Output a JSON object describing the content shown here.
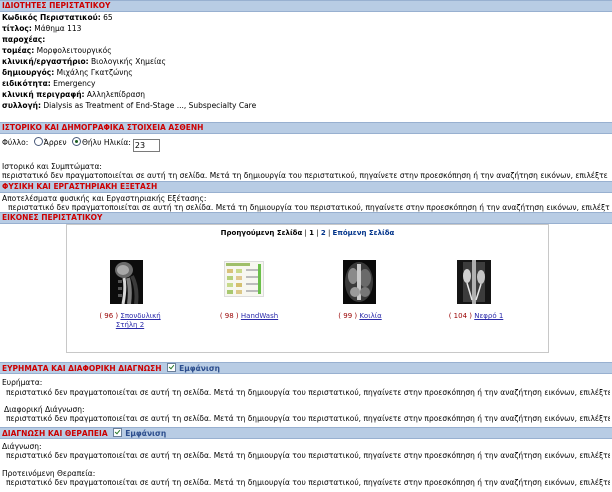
{
  "sections": {
    "properties": "ΙΔΙΟΤΗΤΕΣ ΠΕΡΙΣΤΑΤΙΚΟΥ",
    "history": "ΙΣΤΟΡΙΚΟ ΚΑΙ ΔΗΜΟΓΡΑΦΙΚΑ ΣΤΟΙΧΕΙΑ ΑΣΘΕΝΗ",
    "exam": "ΦΥΣΙΚΗ ΚΑΙ ΕΡΓΑΣΤΗΡΙΑΚΗ ΕΞΕΤΑΣΗ",
    "images": "ΕΙΚΟΝΕΣ ΠΕΡΙΣΤΑΤΙΚΟΥ",
    "findings": "ΕΥΡΗΜΑΤΑ ΚΑΙ ΔΙΑΦΟΡΙΚΗ ΔΙΑΓΝΩΣΗ",
    "diagnosis": "ΔΙΑΓΝΩΣΗ ΚΑΙ ΘΕΡΑΠΕΙΑ",
    "show_label": "Εμφάνιση"
  },
  "properties": [
    {
      "label": "Κωδικός Περιστατικού:",
      "value": "  65"
    },
    {
      "label": "τίτλος:",
      "value": " Μάθημα 113"
    },
    {
      "label": "παροχέας:",
      "value": ""
    },
    {
      "label": "τομέας:",
      "value": " Μορφολειτουργικός"
    },
    {
      "label": "κλινική/εργαστήριο:",
      "value": " Βιολογικής Χημείας"
    },
    {
      "label": "δημιουργός:",
      "value": " Μιχάλης Γκατζώνης"
    },
    {
      "label": "ειδικότητα:",
      "value": " Emergency"
    },
    {
      "label": "κλινική περιγραφή:",
      "value": " Αλληλεπίδραση"
    },
    {
      "label": "συλλογή:",
      "value": " Dialysis as Treatment of End-Stage ..., Subspecialty Care"
    }
  ],
  "demographics": {
    "sex_label": "Φύλλο:",
    "male": "Άρρεν",
    "female": "Θήλυ",
    "age_label": "Ηλικία:",
    "age_value": "23"
  },
  "history": {
    "label": "Ιστορικό και Συμπτώματα:",
    "text": "περιστατικό δεν πραγματοποιείται σε αυτή τη σελίδα. Μετά τη δημιουργία του περιστατικού, πηγαίνετε στην προεσκόπηση ή την αναζήτηση εικόνων, επιλέξτε την εικόνα (ή τις εικόνες) που θέλετε"
  },
  "exam": {
    "label": "Αποτελέσματα φυσικής και Εργαστηριακής Εξέτασης:",
    "text": "περιστατικό δεν πραγματοποιείται σε αυτή τη σελίδα. Μετά τη δημιουργία του περιστατικού, πηγαίνετε στην προεσκόπηση ή την αναζήτηση εικόνων, επιλέξτε την εικόνα (ή τις εικόνες) που θέλετε"
  },
  "gallery": {
    "prev": "Προηγούμενη Σελίδα",
    "sep": "|",
    "page1": "1",
    "page2": "2",
    "next": "Επόμενη Σελίδα",
    "items": [
      {
        "num": "( 96 )",
        "name": "Σπονδυλική",
        "name2": "Στήλη 2"
      },
      {
        "num": "( 98 )",
        "name": "HandWash",
        "name2": ""
      },
      {
        "num": "( 99 )",
        "name": "Κοιλία",
        "name2": ""
      },
      {
        "num": "( 104 )",
        "name": "Νεφρό 1",
        "name2": ""
      }
    ]
  },
  "findings": {
    "label1": "Ευρήματα:",
    "text1": "περιστατικό δεν πραγματοποιείται σε αυτή τη σελίδα. Μετά τη δημιουργία του περιστατικού, πηγαίνετε στην προεσκόπηση ή την αναζήτηση εικόνων, επιλέξτε την εικόνα (ή τις εικόνες) που θέλετε",
    "label2": "Διαφορική Διάγνωση:",
    "text2": "περιστατικό δεν πραγματοποιείται σε αυτή τη σελίδα. Μετά τη δημιουργία του περιστατικού, πηγαίνετε στην προεσκόπηση ή την αναζήτηση εικόνων, επιλέξτε την εικόνα (ή τις εικόνες) που θέλετε"
  },
  "diagnosis": {
    "label1": "Διάγνωση:",
    "text1": "περιστατικό δεν πραγματοποιείται σε αυτή τη σελίδα. Μετά τη δημιουργία του περιστατικού, πηγαίνετε στην προεσκόπηση ή την αναζήτηση εικόνων, επιλέξτε την εικόνα (ή τις εικόνες) που θέλετε",
    "label2": "Προτεινόμενη Θεραπεία:",
    "text2": "περιστατικό δεν πραγματοποιείται σε αυτή τη σελίδα. Μετά τη δημιουργία του περιστατικού, πηγαίνετε στην προεσκόπηση ή την αναζήτηση εικόνων, επιλέξτε την εικόνα (ή τις εικόνες) που θέλετε"
  },
  "colors": {
    "header_bg": "#b8cce4",
    "header_text": "#cc0000",
    "link": "#2a2aaa"
  }
}
